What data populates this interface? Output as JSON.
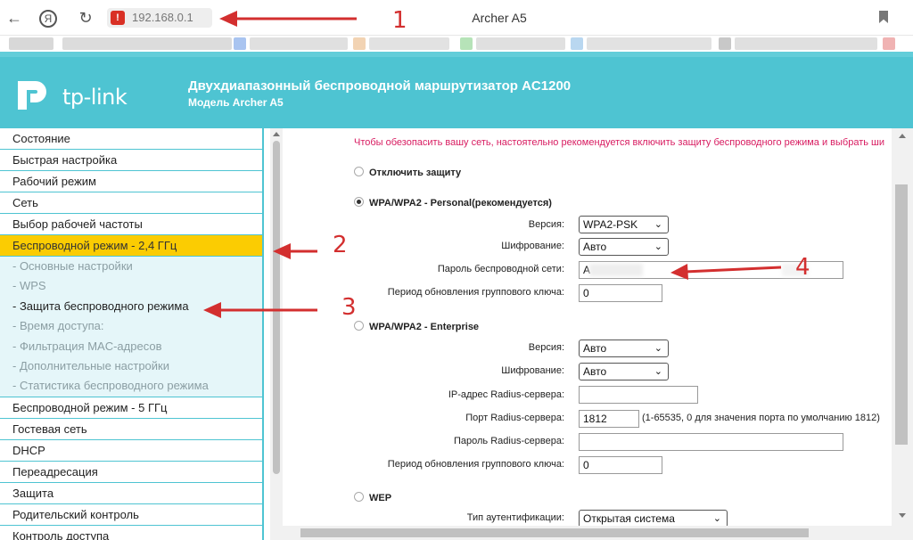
{
  "browser": {
    "url": "192.168.0.1",
    "tab_title": "Archer A5",
    "icons": [
      "back-icon",
      "yandex-icon",
      "reload-icon",
      "warning-icon",
      "bookmark-icon"
    ]
  },
  "header": {
    "logo_text": "tp-link",
    "title": "Двухдиапазонный беспроводной маршрутизатор AC1200",
    "subtitle": "Модель Archer A5",
    "color": "#4ec4d2"
  },
  "sidebar": {
    "items_top": [
      "Состояние",
      "Быстрая настройка",
      "Рабочий режим",
      "Сеть",
      "Выбор рабочей частоты"
    ],
    "active": "Беспроводной режим - 2,4 ГГц",
    "subitems": [
      "- Основные настройки",
      "- WPS",
      "- Защита беспроводного режима",
      "- Время доступа:",
      "- Фильтрация MAC-адресов",
      "- Дополнительные настройки",
      "- Статистика беспроводного режима"
    ],
    "items_bottom": [
      "Беспроводной режим - 5 ГГц",
      "Гостевая сеть",
      "DHCP",
      "Переадресация",
      "Защита",
      "Родительский контроль",
      "Контроль доступа"
    ],
    "active_color": "#fbcc02"
  },
  "content": {
    "notice": "Чтобы обезопасить вашу сеть, настоятельно рекомендуется включить защиту беспроводного режима и выбрать ши",
    "disable_label": "Отключить защиту",
    "personal": {
      "label": "WPA/WPA2 - Personal(рекомендуется)",
      "version_label": "Версия:",
      "version_value": "WPA2-PSK",
      "encryption_label": "Шифрование:",
      "encryption_value": "Авто",
      "password_label": "Пароль беспроводной сети:",
      "password_value": "А",
      "period_label": "Период обновления группового ключа:",
      "period_value": "0"
    },
    "enterprise": {
      "label": "WPA/WPA2 - Enterprise",
      "version_label": "Версия:",
      "version_value": "Авто",
      "encryption_label": "Шифрование:",
      "encryption_value": "Авто",
      "radius_ip_label": "IP-адрес Radius-сервера:",
      "radius_ip_value": "",
      "radius_port_label": "Порт Radius-сервера:",
      "radius_port_value": "1812",
      "radius_port_hint": "(1-65535, 0 для значения порта по умолчанию 1812)",
      "radius_password_label": "Пароль Radius-сервера:",
      "radius_password_value": "",
      "period_label": "Период обновления группового ключа:",
      "period_value": "0"
    },
    "wep": {
      "label": "WEP",
      "auth_label": "Тип аутентификации:",
      "auth_value": "Открытая система"
    }
  },
  "annotations": [
    "1",
    "2",
    "3",
    "4"
  ],
  "annotation_color": "#d32f2f"
}
